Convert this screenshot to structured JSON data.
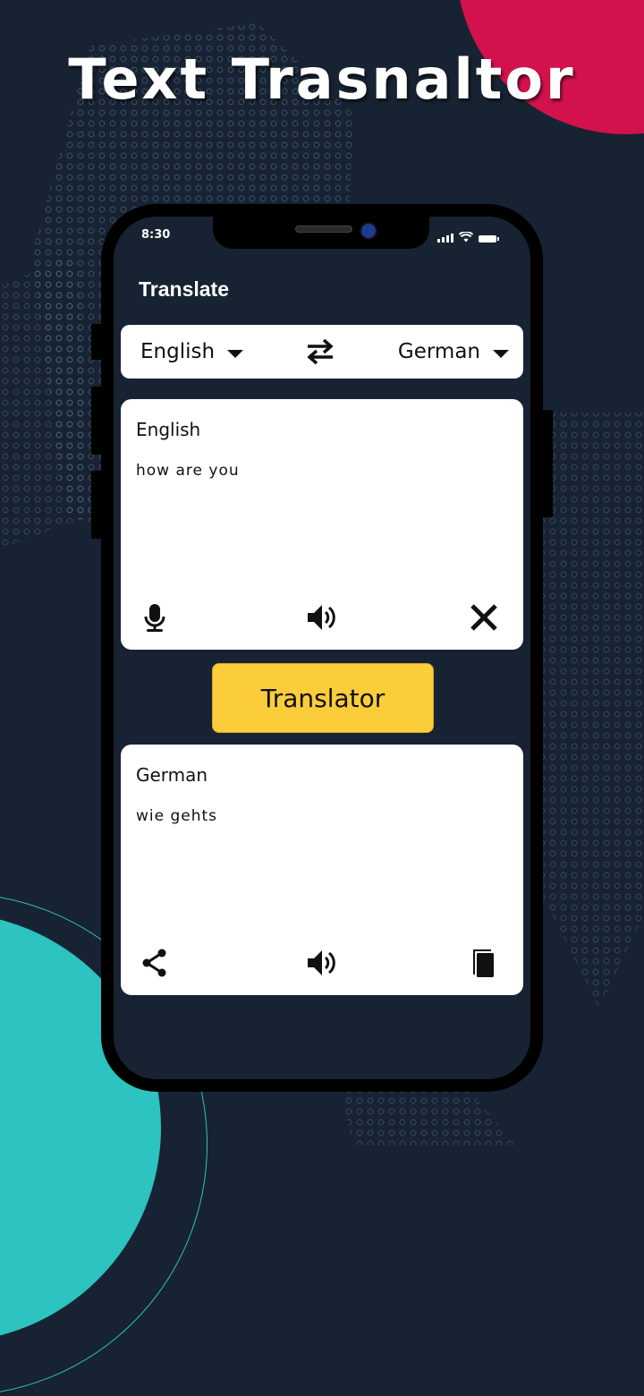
{
  "hero": {
    "title": "Text Trasnaltor"
  },
  "status_bar": {
    "time": "8:30",
    "icons": [
      "signal-icon",
      "wifi-icon",
      "battery-icon"
    ]
  },
  "app": {
    "title": "Translate"
  },
  "language_bar": {
    "source_language": "English",
    "target_language": "German",
    "swap_icon": "swap-arrows-icon",
    "caret_icon": "caret-down-icon"
  },
  "input_card": {
    "language_label": "English",
    "text": "how are you",
    "actions": [
      "microphone-icon",
      "speaker-icon",
      "close-icon"
    ]
  },
  "translate_button": {
    "label": "Translator"
  },
  "output_card": {
    "language_label": "German",
    "text": "wie gehts",
    "actions": [
      "share-icon",
      "speaker-icon",
      "copy-icon"
    ]
  },
  "colors": {
    "background": "#172332",
    "accent_button": "#fccd3b",
    "pink_decoration": "#d3124d",
    "teal_decoration": "#2cc3c0"
  }
}
